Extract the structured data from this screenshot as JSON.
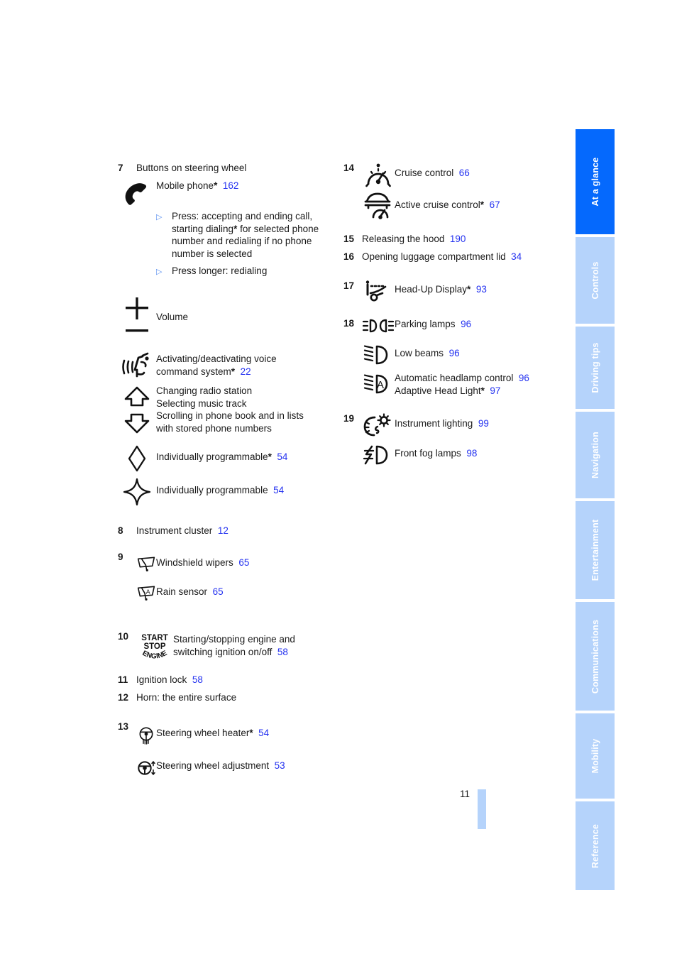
{
  "page": {
    "number": "11"
  },
  "sidebar": {
    "tabs": [
      {
        "label": "At a glance",
        "active": true
      },
      {
        "label": "Controls",
        "active": false
      },
      {
        "label": "Driving tips",
        "active": false
      },
      {
        "label": "Navigation",
        "active": false
      },
      {
        "label": "Entertainment",
        "active": false
      },
      {
        "label": "Communications",
        "active": false
      },
      {
        "label": "Mobility",
        "active": false
      },
      {
        "label": "Reference",
        "active": false
      }
    ],
    "active_color": "#0569fd",
    "inactive_color": "#b5d3fb",
    "text_color": "#ffffff"
  },
  "colors": {
    "page_ref": "#2432f0",
    "bullet": "#5a8ff0"
  },
  "left_column": {
    "item7": {
      "number": "7",
      "title": "Buttons on steering wheel",
      "phone": {
        "label": "Mobile phone",
        "star": "*",
        "page": "162"
      },
      "bullets": [
        "Press: accepting and ending call, starting dialing* for selected phone number and redialing if no phone number is selected",
        "Press longer: redialing"
      ],
      "bullet1_parts": {
        "a": "Press: accepting and ending call, starting dialing",
        "star": "*",
        "b": " for selected phone number and redialing if no phone number is selected"
      },
      "volume": "Volume",
      "voice": {
        "line1": "Activating/deactivating voice",
        "line2": "command system",
        "star": "*",
        "page": "22"
      },
      "radio": {
        "line1": "Changing radio station",
        "line2": "Selecting music track",
        "line3": "Scrolling in phone book and in lists",
        "line4": "with stored phone numbers"
      },
      "prog_star": {
        "label": "Individually programmable",
        "star": "*",
        "page": "54"
      },
      "prog": {
        "label": "Individually programmable",
        "page": "54"
      }
    },
    "item8": {
      "number": "8",
      "label": "Instrument cluster",
      "page": "12"
    },
    "item9": {
      "number": "9",
      "wipers": {
        "label": "Windshield wipers",
        "page": "65"
      },
      "rain": {
        "label": "Rain sensor",
        "page": "65"
      }
    },
    "item10": {
      "number": "10",
      "icon_text": {
        "start": "START",
        "stop": "STOP",
        "engine": "ENGINE"
      },
      "line1": "Starting/stopping engine and",
      "line2": "switching ignition on/off",
      "page": "58"
    },
    "item11": {
      "number": "11",
      "label": "Ignition lock",
      "page": "58"
    },
    "item12": {
      "number": "12",
      "label": "Horn: the entire surface"
    },
    "item13": {
      "number": "13",
      "heater": {
        "label": "Steering wheel heater",
        "star": "*",
        "page": "54"
      },
      "adjust": {
        "label": "Steering wheel adjustment",
        "page": "53"
      }
    }
  },
  "right_column": {
    "item14": {
      "number": "14",
      "cruise": {
        "label": "Cruise control",
        "page": "66"
      },
      "active_cruise": {
        "label": "Active cruise control",
        "star": "*",
        "page": "67"
      }
    },
    "item15": {
      "number": "15",
      "label": "Releasing the hood",
      "page": "190"
    },
    "item16": {
      "number": "16",
      "label": "Opening luggage compartment lid",
      "page": "34"
    },
    "item17": {
      "number": "17",
      "hud": {
        "label": "Head-Up Display",
        "star": "*",
        "page": "93"
      }
    },
    "item18": {
      "number": "18",
      "parking": {
        "label": "Parking lamps",
        "page": "96"
      },
      "low_beams": {
        "label": "Low beams",
        "page": "96"
      },
      "auto": {
        "label": "Automatic headlamp control",
        "page": "96"
      },
      "adaptive": {
        "label": "Adaptive Head Light",
        "star": "*",
        "page": "97"
      }
    },
    "item19": {
      "number": "19",
      "instrument": {
        "label": "Instrument lighting",
        "page": "99"
      },
      "fog": {
        "label": "Front fog lamps",
        "page": "98"
      }
    }
  }
}
